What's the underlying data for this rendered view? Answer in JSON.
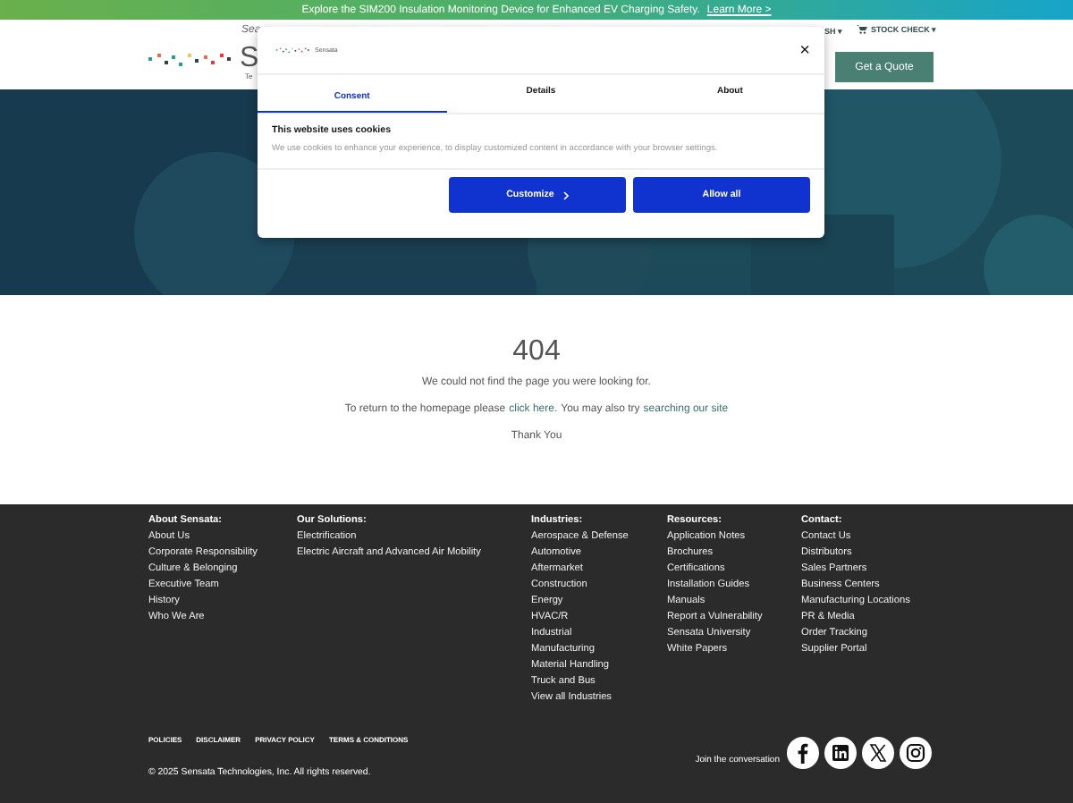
{
  "banner": {
    "text": "Explore the SIM200 Insulation Monitoring Device for Enhanced EV Charging Safety.",
    "link": "Learn More >"
  },
  "header": {
    "search_hint": "Sea",
    "logo_letter": "S",
    "logo_tagline": "Te",
    "language": "SH ▾",
    "stock_check": "STOCK CHECK ▾",
    "quote_button": "Get a Quote"
  },
  "cookie_dialog": {
    "brand": "Sensata",
    "close": "×",
    "tabs": [
      {
        "label": "Consent",
        "selected": true
      },
      {
        "label": "Details",
        "selected": false
      },
      {
        "label": "About",
        "selected": false
      }
    ],
    "title": "This website uses cookies",
    "body": "We use cookies to enhance your experience, to display customized content in accordance with your browser settings.",
    "buttons": [
      {
        "label": "Customize",
        "kind": "chevron"
      },
      {
        "label": "Allow all",
        "kind": "plain"
      }
    ]
  },
  "error": {
    "code": "404",
    "message": "We could not find the page you were looking for.",
    "return_before": "To return to the homepage please",
    "return_link": "click here.",
    "search_before": "You may also try",
    "search_link": "searching our site",
    "thanks": "Thank You"
  },
  "footer": {
    "columns": [
      {
        "heading": "About Sensata:",
        "links": [
          "About Us",
          "Corporate Responsibility",
          "Culture & Belonging",
          "Executive Team",
          "History",
          "Who We Are"
        ]
      },
      {
        "heading": "Our Solutions:",
        "links": [
          "Electrification",
          "Electric Aircraft and Advanced Air Mobility"
        ]
      },
      {
        "heading": "Industries:",
        "links": [
          "Aerospace & Defense",
          "Automotive",
          "Aftermarket",
          "Construction",
          "Energy",
          "HVAC/R",
          "Industrial",
          "Manufacturing",
          "Material Handling",
          "Truck and Bus",
          "View all Industries"
        ]
      },
      {
        "heading": "Resources:",
        "links": [
          "Application Notes",
          "Brochures",
          "Certifications",
          "Installation Guides",
          "Manuals",
          "Report a Vulnerability",
          "Sensata University",
          "White Papers"
        ]
      },
      {
        "heading": "Contact:",
        "links": [
          "Contact Us",
          "Distributors",
          "Sales Partners",
          "Business Centers",
          "Manufacturing Locations",
          "PR & Media",
          "Order Tracking",
          "Supplier Portal"
        ]
      }
    ],
    "legal_links": [
      "POLICIES",
      "DISCLAIMER",
      "PRIVACY POLICY",
      "TERMS & CONDITIONS"
    ],
    "copyright": "©  2025 Sensata Technologies, Inc. All rights reserved.",
    "social_label": "Join the conversation",
    "social": [
      {
        "kind": "facebook"
      },
      {
        "kind": "linkedin"
      },
      {
        "kind": "x"
      },
      {
        "kind": "instagram"
      }
    ]
  }
}
